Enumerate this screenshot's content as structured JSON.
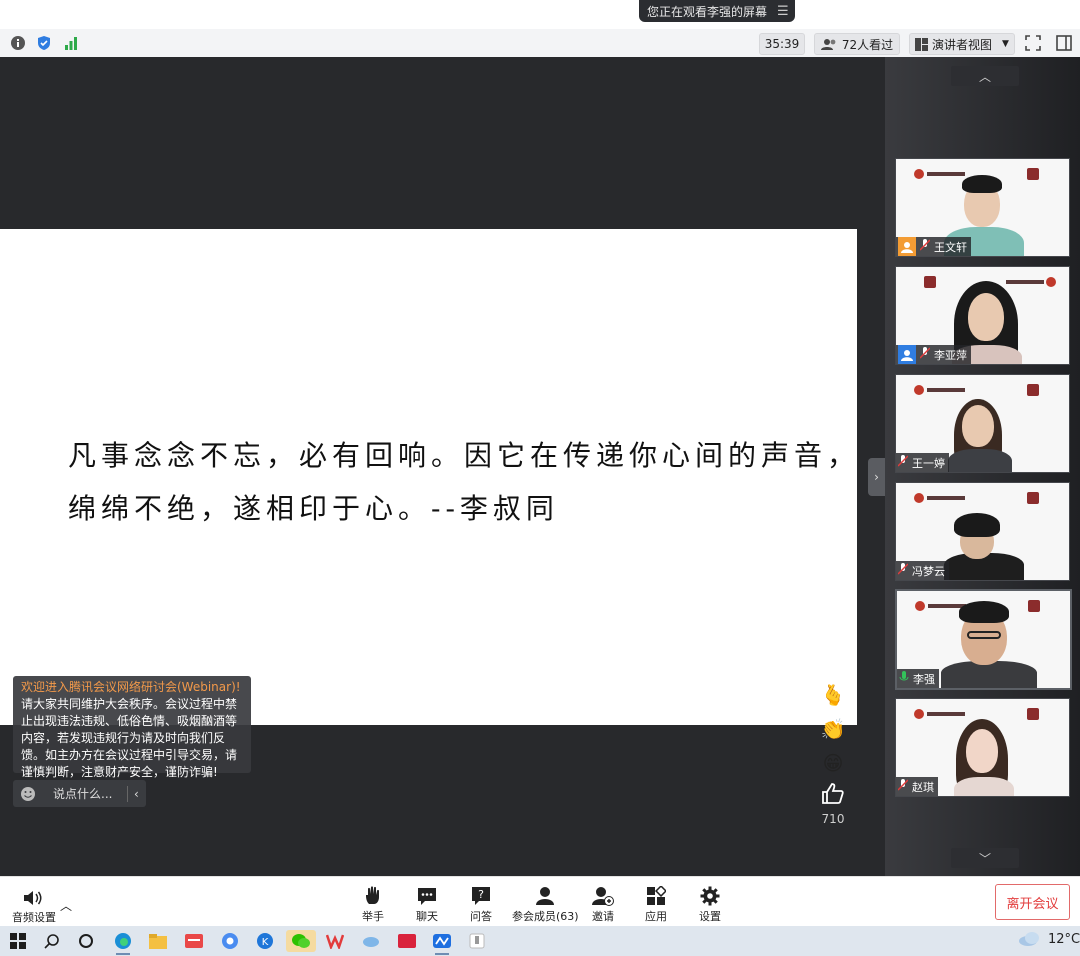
{
  "notice": {
    "text": "您正在观看李强的屏幕"
  },
  "toolbar": {
    "timer": "35:39",
    "viewers": "72人看过",
    "view_mode": "演讲者视图"
  },
  "slide": {
    "line1": "凡事念念不忘，必有回响。因它在传递你心间的声音，",
    "line2": "绵绵不绝，遂相印于心。--李叔同"
  },
  "participants": [
    {
      "name": "王文轩",
      "role": "host"
    },
    {
      "name": "李亚萍",
      "role": "cohost"
    },
    {
      "name": "王一婷",
      "role": "member"
    },
    {
      "name": "冯梦云",
      "role": "member"
    },
    {
      "name": "李强",
      "role": "speaking"
    },
    {
      "name": "赵琪",
      "role": "member"
    }
  ],
  "chat": {
    "welcome": "欢迎进入腾讯会议网络研讨会(Webinar)!",
    "rules": "请大家共同维护大会秩序。会议过程中禁止出现违法违规、低俗色情、吸烟酗酒等内容，若发现违规行为请及时向我们反馈。如主办方在会议过程中引导交易，请谨慎判断，注意财产安全，谨防诈骗!",
    "input_placeholder": "说点什么..."
  },
  "reactions": {
    "like_count": "710"
  },
  "bottom_toolbar": {
    "audio": "音频设置",
    "raise_hand": "举手",
    "chat": "聊天",
    "qa": "问答",
    "members": "参会成员(63)",
    "invite": "邀请",
    "apps": "应用",
    "settings": "设置",
    "leave": "离开会议"
  },
  "taskbar": {
    "temperature": "12°C"
  },
  "colors": {
    "accent_red": "#e23c3c",
    "stage_bg": "#28292c",
    "welcome_orange": "#f2994a"
  }
}
